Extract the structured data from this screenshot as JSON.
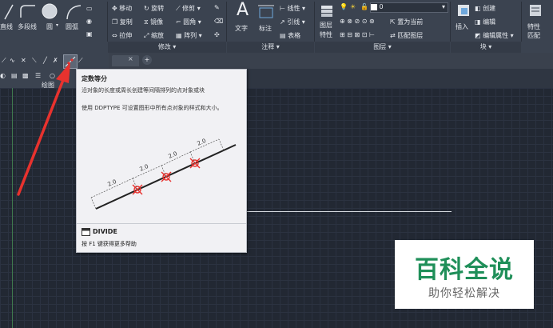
{
  "ribbon": {
    "draw_tools": [
      "直线",
      "多段线",
      "圆",
      "圆弧"
    ],
    "modify_tools": [
      "移动",
      "旋转",
      "修剪",
      "复制",
      "镜像",
      "圆角",
      "拉伸",
      "缩放",
      "阵列"
    ],
    "annotate_tools": [
      "文字",
      "标注",
      "线性",
      "引线",
      "表格"
    ],
    "layer_tools": [
      "图层",
      "特性",
      "置为当前",
      "匹配图层"
    ],
    "layer_value": "0",
    "block_tools": [
      "插入",
      "创建",
      "编辑",
      "编辑属性"
    ],
    "props_tools": [
      "特性",
      "匹配"
    ],
    "panel_labels": [
      "修改",
      "注释",
      "图层",
      "块"
    ],
    "draw_panel_label": "绘图"
  },
  "file_tab": {
    "close_symbol": "×",
    "add_symbol": "+"
  },
  "tooltip": {
    "title": "定数等分",
    "description": "沿对象的长度或周长创建等间隔排列的点对象或块",
    "extra": "使用 DDPTYPE 可设置图形中所有点对象的样式和大小。",
    "dimension_label": "2.0",
    "command": "DIVIDE",
    "help": "按 F1 键获得更多帮助"
  },
  "watermark": {
    "title": "百科全说",
    "subtitle": "助你轻松解决"
  },
  "colors": {
    "arrow": "#e8322e",
    "accent": "#1f8f59"
  }
}
